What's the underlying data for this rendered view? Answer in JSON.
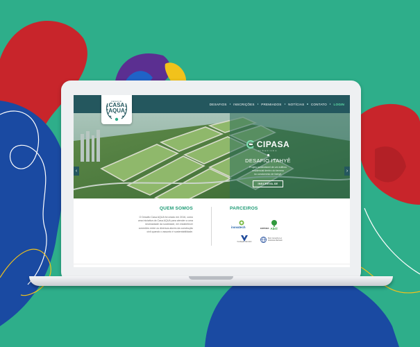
{
  "theme": {
    "background": "#2eae8a",
    "accent_red": "#c8252b",
    "accent_blue": "#1a4aa2",
    "accent_yellow": "#f2c21b",
    "accent_purple": "#5b2f91",
    "nav_bg": "#24575e",
    "brand_green": "#1c9a74"
  },
  "site": {
    "logo": {
      "top_text": "DESAFIO",
      "name_line1": "CASA",
      "name_line2": "AQUA",
      "icon": "laurel-badge-icon"
    },
    "nav": {
      "items": [
        "DESAFIOS",
        "INSCRIÇÕES",
        "PREMIADOS",
        "NOTÍCIAS",
        "CONTATO"
      ],
      "login": "LOGIN"
    }
  },
  "hero": {
    "sponsor_name": "CIPASA",
    "sponsor_tagline": "urbanismo",
    "title": "DESAFIO ITAHYÊ",
    "description": [
      "Projeto sustentável de um edifício",
      "residencial dentro do terreno",
      "no condomínio de Itahyê."
    ],
    "cta_label": "INSCREVA-SE",
    "prev_icon": "chevron-left-icon",
    "next_icon": "chevron-right-icon"
  },
  "about": {
    "title": "QUEM SOMOS",
    "lines": [
      "O Desafio Casa AQUA foi criado em 2016, como",
      "uma iniciativa da Casa AQUA para atender a uma",
      "necessidade da sociedade, em estabelecer",
      "conexões entre os diversos atores da construção",
      "civil quando o assunto é sustentabilidade."
    ]
  },
  "partners": {
    "title": "PARCEIROS",
    "items": [
      {
        "name": "inovatech",
        "icon": "inovatech-logo-icon"
      },
      {
        "prefix": "EDITORA",
        "name": "Abril",
        "icon": "abril-tree-icon"
      },
      {
        "name": "Fundação Vanzolini",
        "icon": "vanzolini-logo-icon"
      },
      {
        "line1": "Bom Conselho Luz",
        "line2": "Alcântara Machado",
        "icon": "globe-logo-icon"
      }
    ]
  }
}
